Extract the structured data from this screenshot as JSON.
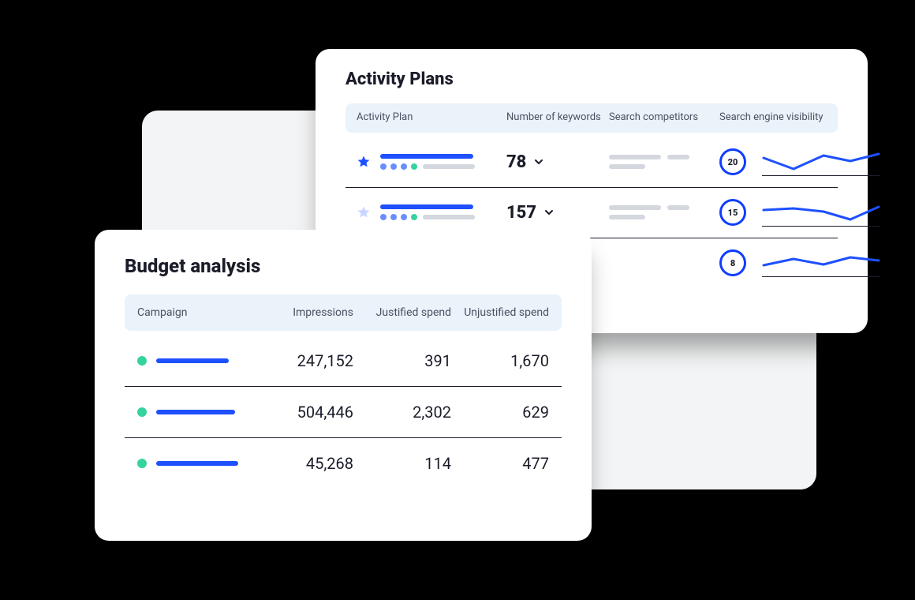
{
  "activity": {
    "title": "Activity Plans",
    "headers": {
      "plan": "Activity Plan",
      "keywords": "Number of keywords",
      "competitors": "Search competitors",
      "visibility": "Search engine visibility"
    },
    "rows": [
      {
        "starred": true,
        "keywords": "78",
        "visibility": "20"
      },
      {
        "starred": false,
        "keywords": "157",
        "visibility": "15"
      },
      {
        "starred": false,
        "keywords": "",
        "visibility": "8"
      }
    ]
  },
  "budget": {
    "title": "Budget analysis",
    "headers": {
      "campaign": "Campaign",
      "impressions": "Impressions",
      "justified": "Justified spend",
      "unjustified": "Unjustified spend"
    },
    "rows": [
      {
        "impressions": "247,152",
        "justified": "391",
        "unjustified": "1,670"
      },
      {
        "impressions": "504,446",
        "justified": "2,302",
        "unjustified": "629"
      },
      {
        "impressions": "45,268",
        "justified": "114",
        "unjustified": "477"
      }
    ]
  },
  "chart_data": [
    {
      "type": "line",
      "title": "Search engine visibility row 1",
      "x": [
        0,
        1,
        2,
        3,
        4
      ],
      "values": [
        20,
        12,
        22,
        18,
        24
      ],
      "ylim": [
        0,
        30
      ]
    },
    {
      "type": "line",
      "title": "Search engine visibility row 2",
      "x": [
        0,
        1,
        2,
        3,
        4
      ],
      "values": [
        18,
        20,
        17,
        12,
        20
      ],
      "ylim": [
        0,
        30
      ]
    },
    {
      "type": "line",
      "title": "Search engine visibility row 3",
      "x": [
        0,
        1,
        2,
        3,
        4
      ],
      "values": [
        14,
        18,
        15,
        20,
        18
      ],
      "ylim": [
        0,
        30
      ]
    }
  ]
}
